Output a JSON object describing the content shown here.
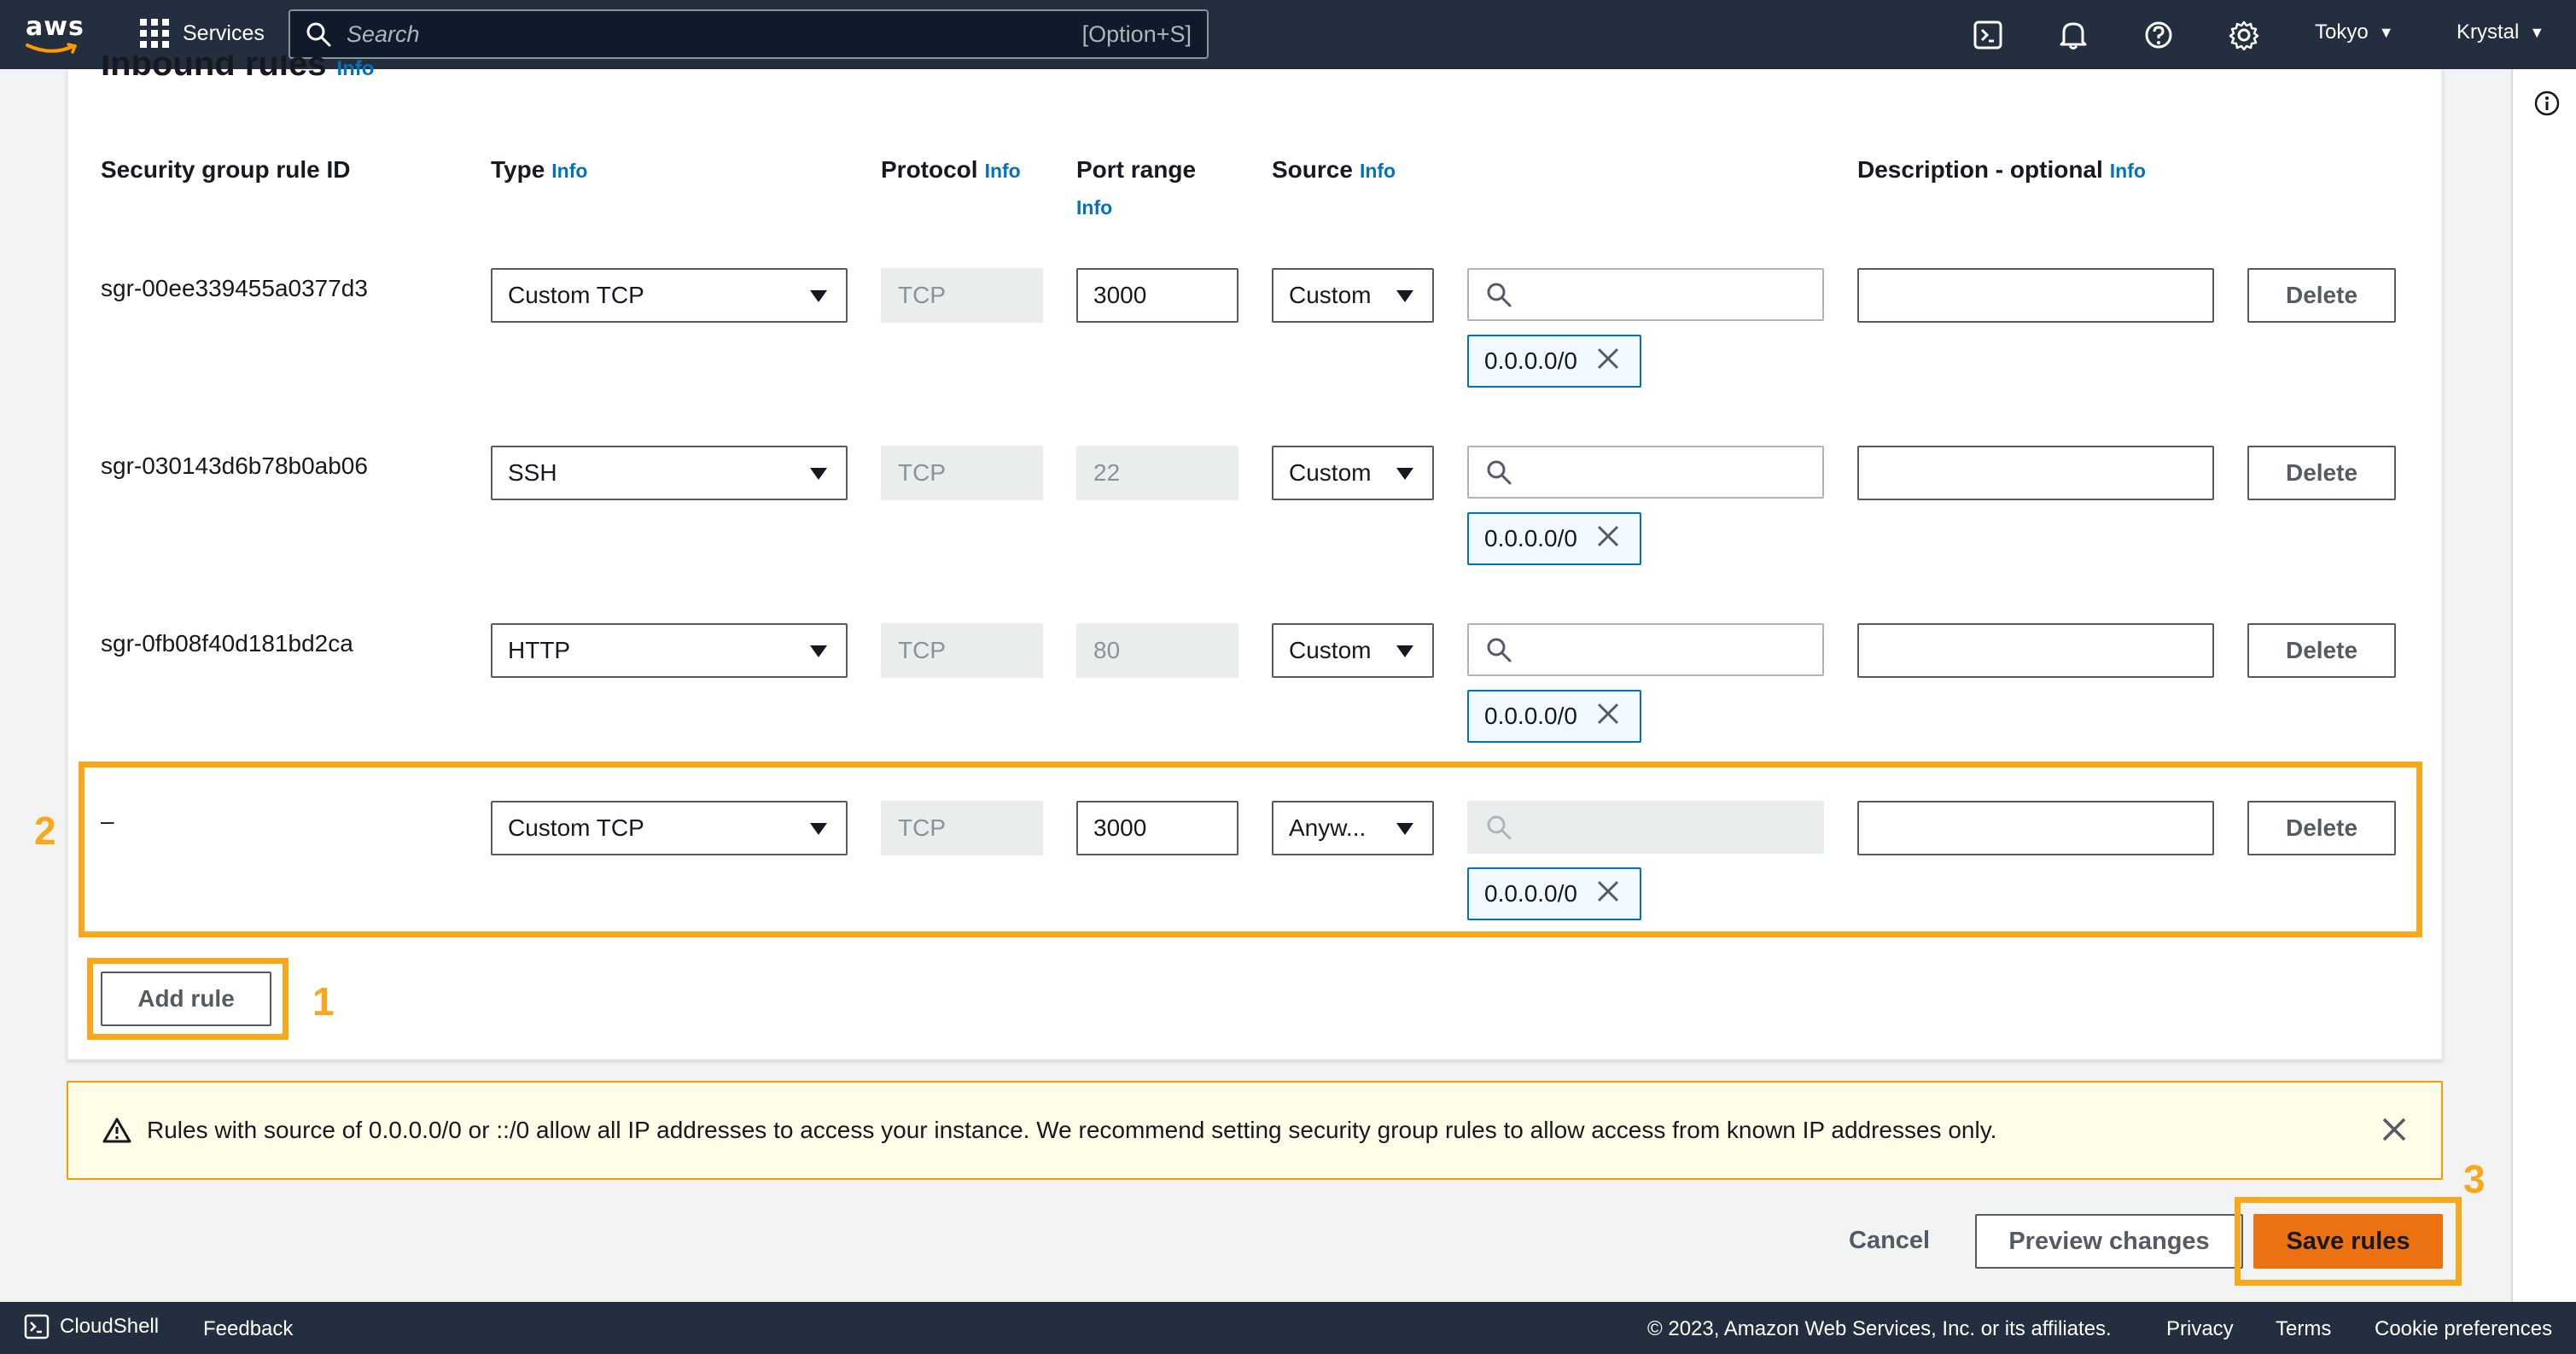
{
  "nav": {
    "logo": "aws",
    "services_label": "Services",
    "search_placeholder": "Search",
    "search_shortcut": "[Option+S]",
    "region": "Tokyo",
    "user": "Krystal"
  },
  "panel": {
    "title": "Inbound rules",
    "title_info": "Info",
    "columns": {
      "rule_id": "Security group rule ID",
      "type": "Type",
      "protocol": "Protocol",
      "port_range": "Port range",
      "source": "Source",
      "description": "Description - optional",
      "info": "Info"
    },
    "rules": [
      {
        "id": "sgr-00ee339455a0377d3",
        "type": "Custom TCP",
        "protocol": "TCP",
        "port": "3000",
        "source": "Custom",
        "cidr": "0.0.0.0/0",
        "delete": "Delete"
      },
      {
        "id": "sgr-030143d6b78b0ab06",
        "type": "SSH",
        "protocol": "TCP",
        "port": "22",
        "source": "Custom",
        "cidr": "0.0.0.0/0",
        "delete": "Delete"
      },
      {
        "id": "sgr-0fb08f40d181bd2ca",
        "type": "HTTP",
        "protocol": "TCP",
        "port": "80",
        "source": "Custom",
        "cidr": "0.0.0.0/0",
        "delete": "Delete"
      },
      {
        "id": "–",
        "type": "Custom TCP",
        "protocol": "TCP",
        "port": "3000",
        "source": "Anyw...",
        "cidr": "0.0.0.0/0",
        "delete": "Delete"
      }
    ],
    "add_rule": "Add rule"
  },
  "callouts": {
    "one": "1",
    "two": "2",
    "three": "3"
  },
  "warning": {
    "text": "Rules with source of 0.0.0.0/0 or ::/0 allow all IP addresses to access your instance. We recommend setting security group rules to allow access from known IP addresses only."
  },
  "actions": {
    "cancel": "Cancel",
    "preview": "Preview changes",
    "save": "Save rules"
  },
  "footer": {
    "cloudshell": "CloudShell",
    "feedback": "Feedback",
    "copyright": "© 2023, Amazon Web Services, Inc. or its affiliates.",
    "privacy": "Privacy",
    "terms": "Terms",
    "cookies": "Cookie preferences"
  },
  "colors": {
    "nav_bg": "#232f3e",
    "link": "#0073bb",
    "highlight": "#f9a81c",
    "primary": "#ec7211",
    "warning_bg": "#fffce8"
  }
}
